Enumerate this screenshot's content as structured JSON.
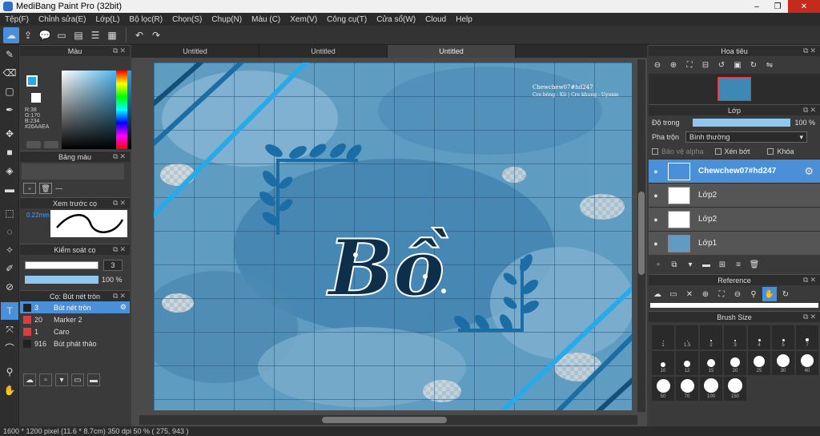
{
  "app": {
    "title": "MediBang Paint Pro (32bit)",
    "window_buttons": [
      "–",
      "❐",
      "✕"
    ]
  },
  "menu": [
    "Tệp(F)",
    "Chỉnh sửa(E)",
    "Lớp(L)",
    "Bộ lọc(R)",
    "Chọn(S)",
    "Chụp(N)",
    "Màu (C)",
    "Xem(V)",
    "Công cụ(T)",
    "Cửa sổ(W)",
    "Cloud",
    "Help"
  ],
  "tabs": [
    "Untitled",
    "Untitled",
    "Untitled"
  ],
  "color_panel": {
    "title": "Màu",
    "rgb_r": "R:38",
    "rgb_g": "G:170",
    "rgb_b": "B:234",
    "hex": "#26AAEA",
    "fg_color": "#26aaea"
  },
  "palette_panel": {
    "title": "Bảng màu",
    "dashes": "---"
  },
  "preview_panel": {
    "title": "Xem trước cọ",
    "size": "0.22mm"
  },
  "control_panel": {
    "title": "Kiểm soát cọ",
    "size_value": "3",
    "opacity_value": "100 %"
  },
  "brush_panel": {
    "title": "Cọ: Bút nét tròn",
    "items": [
      {
        "size": "3",
        "name": "Bút nét tròn",
        "color": "#222222"
      },
      {
        "size": "20",
        "name": "Marker 2",
        "color": "#d84040"
      },
      {
        "size": "1",
        "name": "Caro",
        "color": "#d84040"
      },
      {
        "size": "916",
        "name": "Bút phát thảo",
        "color": "#222222"
      }
    ]
  },
  "canvas": {
    "credit_line1": "Chewchew07#hd247",
    "credit_line2": "Cre bông : Kii | Cre khung : Uyunie",
    "main_text": "Bồ"
  },
  "navigator": {
    "title": "Hoa tiêu"
  },
  "layers_panel": {
    "title": "Lớp",
    "opacity_label": "Độ trong",
    "opacity_value": "100 %",
    "blend_label": "Pha trộn",
    "blend_value": "Bình thường",
    "protect_alpha": "Bảo vệ alpha",
    "clipping": "Xén bớt",
    "lock": "Khóa",
    "layers": [
      {
        "name": "Chewchew07#hd247",
        "selected": true
      },
      {
        "name": "Lớp2",
        "selected": false
      },
      {
        "name": "Lớp2",
        "selected": false
      },
      {
        "name": "Lớp1",
        "selected": false
      }
    ]
  },
  "reference_panel": {
    "title": "Reference"
  },
  "brush_size_panel": {
    "title": "Brush Size",
    "sizes": [
      "1",
      "1.5",
      "2",
      "3",
      "4",
      "5",
      "7",
      "10",
      "12",
      "15",
      "20",
      "25",
      "30",
      "40",
      "50",
      "70",
      "100",
      "150"
    ]
  },
  "status": {
    "text": "1600 * 1200 pixel    (11.6 * 8.7cm)    350 dpi    50 %    ( 275, 943 )"
  }
}
